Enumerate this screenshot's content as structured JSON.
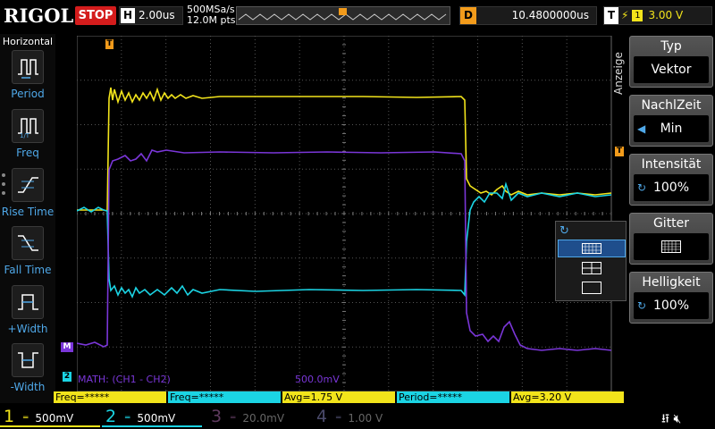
{
  "top": {
    "logo": "RIGOL",
    "run_state": "STOP",
    "h_label": "H",
    "timebase": "2.00us",
    "sample_rate": "500MSa/s",
    "mem_depth": "12.0M pts",
    "d_label": "D",
    "delay": "10.4800000us",
    "t_label": "T",
    "trigger_source": "1",
    "trigger_level": "3.00 V",
    "colors": {
      "stop": "#d41c1c",
      "delay_badge": "#f29b1b",
      "trigger": "#f2e41b"
    }
  },
  "left_panel": {
    "title": "Horizontal",
    "items": [
      {
        "label": "Period",
        "icon": "period-icon"
      },
      {
        "label": "Freq",
        "icon": "freq-icon"
      },
      {
        "label": "Rise Time",
        "icon": "rise-time-icon"
      },
      {
        "label": "Fall Time",
        "icon": "fall-time-icon"
      },
      {
        "label": "+Width",
        "icon": "pos-width-icon"
      },
      {
        "label": "-Width",
        "icon": "neg-width-icon"
      }
    ]
  },
  "screen": {
    "math_label": "MATH: (CH1 - CH2)",
    "math_scale": "500.0mV",
    "markers": {
      "trigger_top": "T",
      "math_ground": "M",
      "ch2_ground": "2",
      "trigger_level": "T"
    },
    "colors": {
      "ch1": "#f2e41b",
      "ch2": "#1bd4e4",
      "math": "#7a36d8",
      "grid": "#555555"
    }
  },
  "measurements": [
    {
      "text": "Freq=*****",
      "color": "yellow"
    },
    {
      "text": "Freq=*****",
      "color": "cyan"
    },
    {
      "text": "Avg=1.75 V",
      "color": "yellow"
    },
    {
      "text": "Period=*****",
      "color": "cyan"
    },
    {
      "text": "Avg=3.20 V",
      "color": "yellow"
    }
  ],
  "right_panel": {
    "side_label": "Anzeige",
    "buttons": [
      {
        "title": "Typ",
        "value": "Vektor"
      },
      {
        "title": "NachlZeit",
        "value": "Min"
      },
      {
        "title": "Intensität",
        "value": "100%"
      },
      {
        "title": "Gitter",
        "value": ""
      },
      {
        "title": "Helligkeit",
        "value": "100%"
      }
    ]
  },
  "grid_popup": {
    "options": [
      "full-grid-icon",
      "half-grid-icon",
      "no-grid-icon"
    ],
    "selected": 0
  },
  "bottom": {
    "channels": [
      {
        "num": "1",
        "scale": "500mV",
        "active": true,
        "color": "#f2e41b"
      },
      {
        "num": "2",
        "scale": "500mV",
        "active": true,
        "color": "#1bd4e4"
      },
      {
        "num": "3",
        "scale": "20.0mV",
        "active": false,
        "color": "#8a2f8a"
      },
      {
        "num": "4",
        "scale": "1.00 V",
        "active": false,
        "color": "#3a3a8a"
      }
    ]
  }
}
